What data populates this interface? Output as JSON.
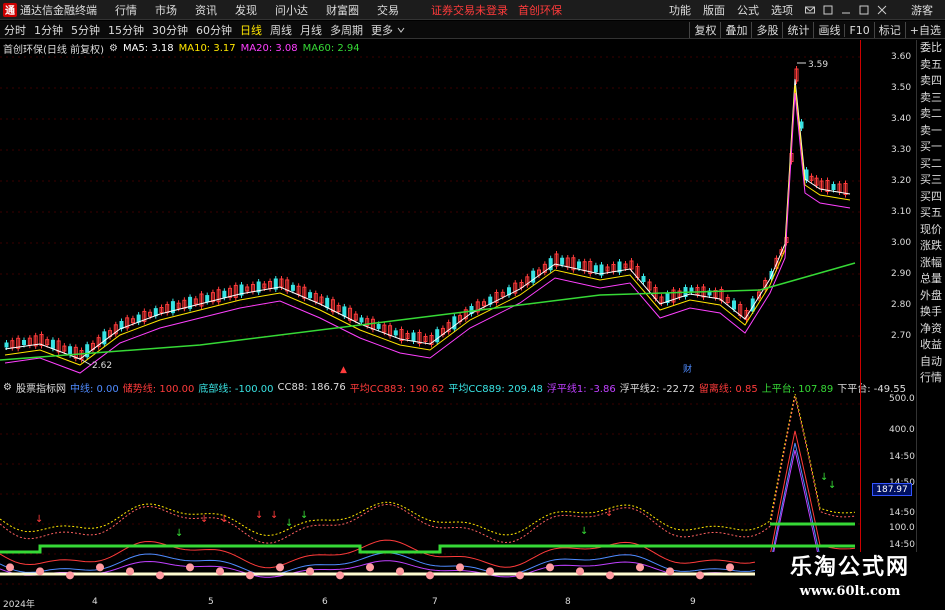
{
  "app": {
    "title": "通达信金融终端",
    "logo": "通"
  },
  "menu": [
    "行情",
    "市场",
    "资讯",
    "发现",
    "问小达",
    "财富圈",
    "交易"
  ],
  "warning": "证券交易未登录",
  "stock_tag": "首创环保",
  "right_menu": [
    "功能",
    "版面",
    "公式",
    "选项"
  ],
  "guest": "游客",
  "periods": [
    "分时",
    "1分钟",
    "5分钟",
    "15分钟",
    "30分钟",
    "60分钟",
    "日线",
    "周线",
    "月线",
    "多周期",
    "更多"
  ],
  "active_period": "日线",
  "right_tools": [
    "复权",
    "叠加",
    "多股",
    "统计",
    "画线",
    "F10",
    "标记",
    "+自选"
  ],
  "indicator1": {
    "title": "首创环保(日线 前复权)",
    "ma5": "MA5: 3.18",
    "ma10": "MA10: 3.17",
    "ma20": "MA20: 3.08",
    "ma60": "MA60: 2.94"
  },
  "price_ticks": [
    "3.60",
    "3.50",
    "3.40",
    "3.30",
    "3.20",
    "3.10",
    "3.00",
    "2.90",
    "2.80",
    "2.70"
  ],
  "annot_high": "3.59",
  "annot_low": "2.62",
  "marker_left": "▲",
  "marker_right": "财",
  "side_labels": [
    "委比",
    "卖五",
    "卖四",
    "卖三",
    "卖二",
    "卖一",
    "买一",
    "买二",
    "买三",
    "买四",
    "买五",
    "现价",
    "涨跌",
    "涨幅",
    "总量",
    "外盘",
    "换手",
    "净资",
    "收益",
    "自动",
    "行情"
  ],
  "indicator2": {
    "title": "股票指标网",
    "items": [
      {
        "t": "中线: 0.00",
        "c": "#4f8bff"
      },
      {
        "t": "储势线: 100.00",
        "c": "#ff3b3b"
      },
      {
        "t": "底部线: -100.00",
        "c": "#39e3e3"
      },
      {
        "t": "CC88: 186.76",
        "c": "#ddd"
      },
      {
        "t": "平均CC883: 190.62",
        "c": "#ff3b3b"
      },
      {
        "t": "平均CC889: 209.48",
        "c": "#39e3e3"
      },
      {
        "t": "浮平线1: -3.86",
        "c": "#c040ff"
      },
      {
        "t": "浮平线2: -22.72",
        "c": "#ddd"
      },
      {
        "t": "留离线: 0.85",
        "c": "#ff3b3b"
      },
      {
        "t": "上平台: 107.89",
        "c": "#36d936"
      },
      {
        "t": "下平台: -49.55",
        "c": "#ddd"
      }
    ]
  },
  "lower_ticks": [
    "500.0",
    "400.0",
    "14:50",
    "14:50",
    "14:50",
    "187.97",
    "100.0",
    "14:50",
    "14:50"
  ],
  "dates": [
    "2024年",
    "4",
    "5",
    "6",
    "7",
    "8",
    "9"
  ],
  "watermark": {
    "line1": "乐淘公式网",
    "line2": "www.60lt.com"
  }
}
